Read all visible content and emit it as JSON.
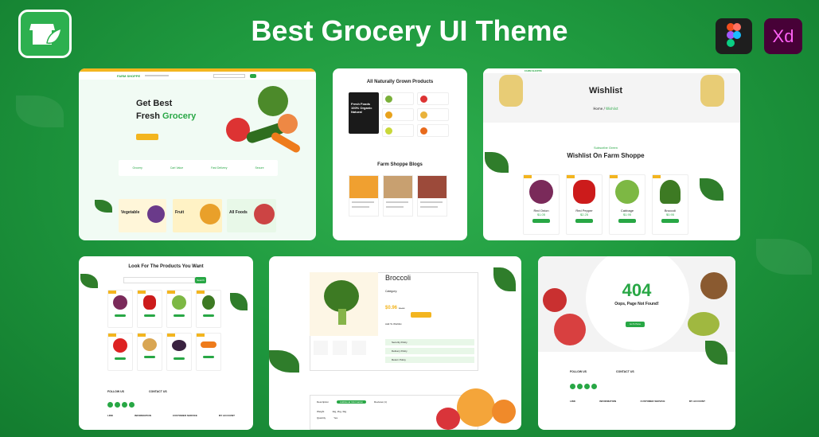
{
  "header": {
    "title": "Best Grocery UI Theme",
    "xd_label": "Xd"
  },
  "brand": {
    "name": "FARM SHOPPE"
  },
  "home": {
    "hero_line1": "Get Best",
    "hero_line2": "Fresh",
    "hero_accent": "Grocery",
    "features": [
      "Grocery",
      "Cart Value",
      "Fast Delivery",
      "Secure"
    ],
    "categories": [
      "Vegetable",
      "Fruit",
      "All Foods"
    ]
  },
  "products_page": {
    "title": "All Naturally Grown Products",
    "promo_line1": "Fresh Foods",
    "promo_line2": "100% Organic",
    "promo_line3": "Natural",
    "blogs_title": "Farm Shoppe Blogs"
  },
  "wishlist": {
    "banner_title": "Wishlist",
    "crumb_home": "Home",
    "crumb_current": "Wishlist",
    "kicker": "Subscribe Green",
    "section_title": "Wishlist On Farm Shoppe",
    "items": [
      {
        "name": "Red Onion",
        "price": "$1.05"
      },
      {
        "name": "Red Pepper",
        "price": "$2.25"
      },
      {
        "name": "Cabbage",
        "price": "$1.95"
      },
      {
        "name": "Broccoli",
        "price": "$0.95"
      }
    ]
  },
  "search_page": {
    "title": "Look For The Products You Want",
    "search_button": "Search",
    "follow_label": "FOLLOW US",
    "contact_label": "CONTACT US",
    "footer_cols": [
      "LINK",
      "INFORMATION",
      "CUSTOMER SERVICE",
      "MY ACCOUNT"
    ]
  },
  "detail_page": {
    "product_name": "Broccoli",
    "price": "$0.96",
    "old_price": "$1.02",
    "category_label": "Category:",
    "wishlist_label": "Add To Wishlist",
    "info_rows": [
      "Security Policy",
      "Delivery Policy",
      "Return Policy"
    ],
    "tabs": [
      "Description",
      "Additional Information",
      "Reviews (1)"
    ],
    "table_rows": [
      {
        "label": "Weight",
        "value": "1kg, 2kg, 3kg"
      },
      {
        "label": "Quantity",
        "value": "Yes"
      }
    ]
  },
  "notfound_page": {
    "code": "404",
    "message": "Oops, Page Not Found!",
    "button": "Go To Home",
    "follow_label": "FOLLOW US",
    "contact_label": "CONTACT US",
    "footer_cols": [
      "LINK",
      "INFORMATION",
      "CUSTOMER SERVICE",
      "MY ACCOUNT"
    ]
  },
  "colors": {
    "brand_green": "#28a745",
    "accent_yellow": "#f3b51f",
    "background": "#1f9a3f"
  }
}
